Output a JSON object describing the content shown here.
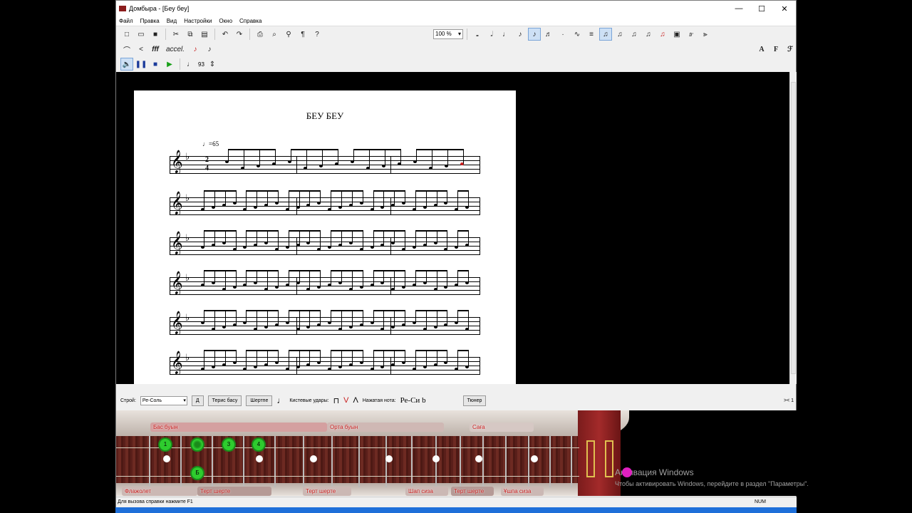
{
  "window": {
    "title": "Домбыра - [Беу беу]",
    "controls": [
      "—",
      "☐",
      "✕"
    ]
  },
  "menu": [
    "Файл",
    "Правка",
    "Вид",
    "Настройки",
    "Окно",
    "Справка"
  ],
  "toolbar1": {
    "zoom": "100 %"
  },
  "toolbar2": {
    "accel": "accel.",
    "crescendo": "fff"
  },
  "toolbar3": {
    "tempo_value": "93"
  },
  "score": {
    "title": "БЕУ БЕУ",
    "tempo": "♩=65",
    "time_sig_top": "2",
    "time_sig_bottom": "4"
  },
  "bottom_panel": {
    "tuning_label": "Строй:",
    "tuning_value": "Ре-Соль",
    "btn_d": "Д",
    "btn_reverse": "Терис басу",
    "btn_shertpe": "Шертпе",
    "strokes_label": "Кистевые удары:",
    "pressed_label": "Нажатая нота:",
    "pressed_note": "Ре-Си b",
    "tuner": "Тюнер",
    "scroll_indicator": ">< 1"
  },
  "dombyra": {
    "top_tabs": [
      "Бас буын",
      "Орта буын",
      "Саға"
    ],
    "bottom_tabs": [
      "Флажолет",
      "Терт шерте",
      "Терт шерте",
      "Шап сиза",
      "Терт шерте",
      "Ұшпа сиза"
    ],
    "finger_numbers": [
      "1",
      "",
      "3",
      "4"
    ],
    "finger_bass": "Б"
  },
  "watermark": {
    "title": "Активация Windows",
    "subtitle": "Чтобы активировать Windows, перейдите в раздел \"Параметры\"."
  },
  "status": {
    "help": "Для вызова справки нажмите F1",
    "num": "NUM"
  }
}
